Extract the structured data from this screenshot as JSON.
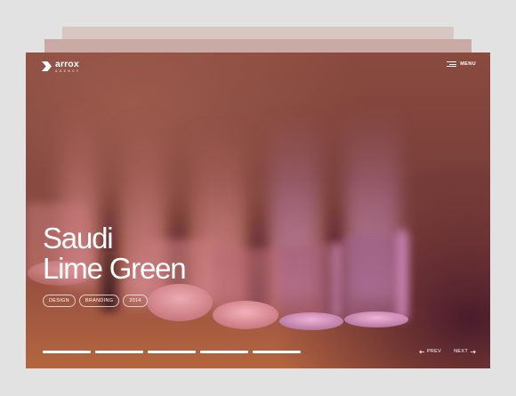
{
  "brand": {
    "name": "arrox",
    "sub": "AGENCY"
  },
  "menu": {
    "label": "MENU"
  },
  "hero": {
    "title_line1": "Saudi",
    "title_line2": "Lime Green"
  },
  "tags": [
    "DESIGN",
    "BRANDING",
    "2014"
  ],
  "slides": {
    "total": 5
  },
  "nav": {
    "prev_label": "PREV",
    "next_label": "NEXT",
    "prev_icon": "arrow-left-icon",
    "next_icon": "arrow-right-icon"
  },
  "colors": {
    "accent": "#ffffff",
    "background": "#e2e2e2",
    "hero_warm": "#b4653f",
    "hero_pink": "#e39ab0",
    "hero_purple": "#4a1b2b"
  }
}
